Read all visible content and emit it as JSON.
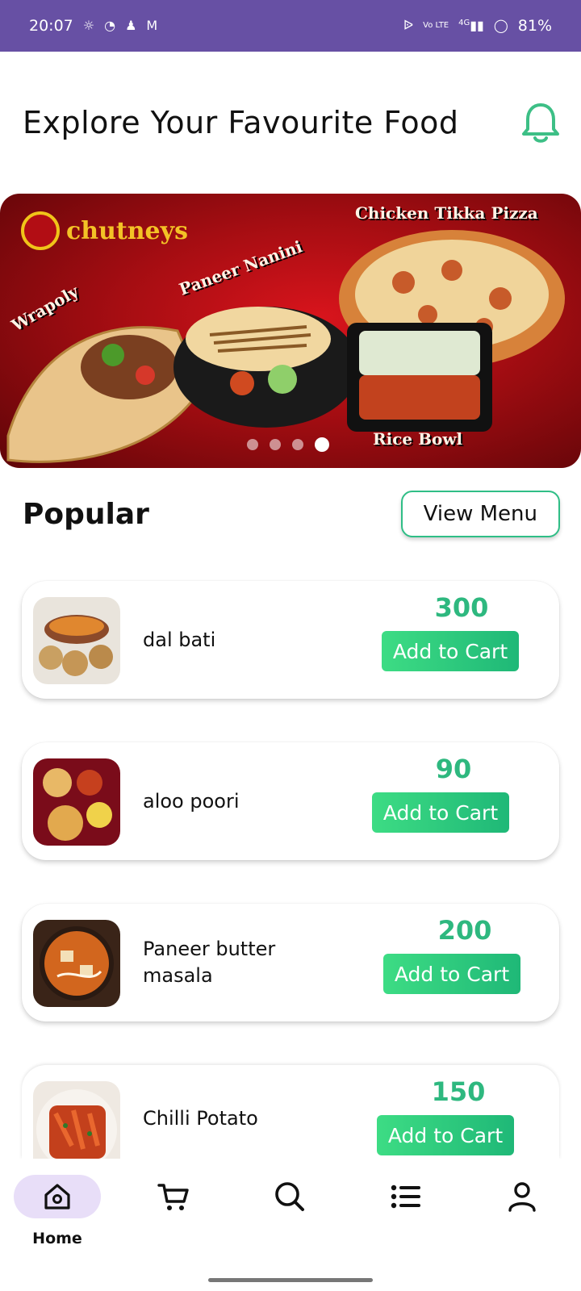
{
  "status_bar": {
    "time": "20:07",
    "battery": "81%",
    "left_icons": [
      "flashlight-icon",
      "pac-icon",
      "app-icon",
      "gmail-icon"
    ],
    "right_icons": [
      "bluetooth-icon",
      "volte-icon",
      "signal-icon",
      "battery-icon"
    ],
    "network": "4G",
    "volte": "Vo LTE",
    "bg_color": "#6750a4"
  },
  "header": {
    "title": "Explore Your Favourite Food",
    "icon": "bell-icon",
    "icon_color": "#3dbf86"
  },
  "banner": {
    "brand": "chutneys",
    "labels": [
      "Wrapoly",
      "Paneer Nanini",
      "Chicken Tikka Pizza",
      "Rice Bowl"
    ],
    "pages": 4,
    "active_page": 4
  },
  "popular": {
    "title": "Popular",
    "view_menu_label": "View Menu"
  },
  "items": [
    {
      "name": "dal bati",
      "price": "300",
      "button": "Add to Cart"
    },
    {
      "name": "aloo poori",
      "price": "90",
      "button": "Add to Cart"
    },
    {
      "name": "Paneer butter masala",
      "price": "200",
      "button": "Add to Cart"
    },
    {
      "name": "Chilli Potato",
      "price": "150",
      "button": "Add to Cart"
    }
  ],
  "bottom_nav": {
    "items": [
      {
        "label": "Home",
        "icon": "home-icon",
        "active": true
      },
      {
        "label": "",
        "icon": "cart-icon",
        "active": false
      },
      {
        "label": "",
        "icon": "search-icon",
        "active": false
      },
      {
        "label": "",
        "icon": "list-icon",
        "active": false
      },
      {
        "label": "",
        "icon": "profile-icon",
        "active": false
      }
    ]
  },
  "colors": {
    "accent": "#2eb87f",
    "nav_active": "#e8def8"
  }
}
